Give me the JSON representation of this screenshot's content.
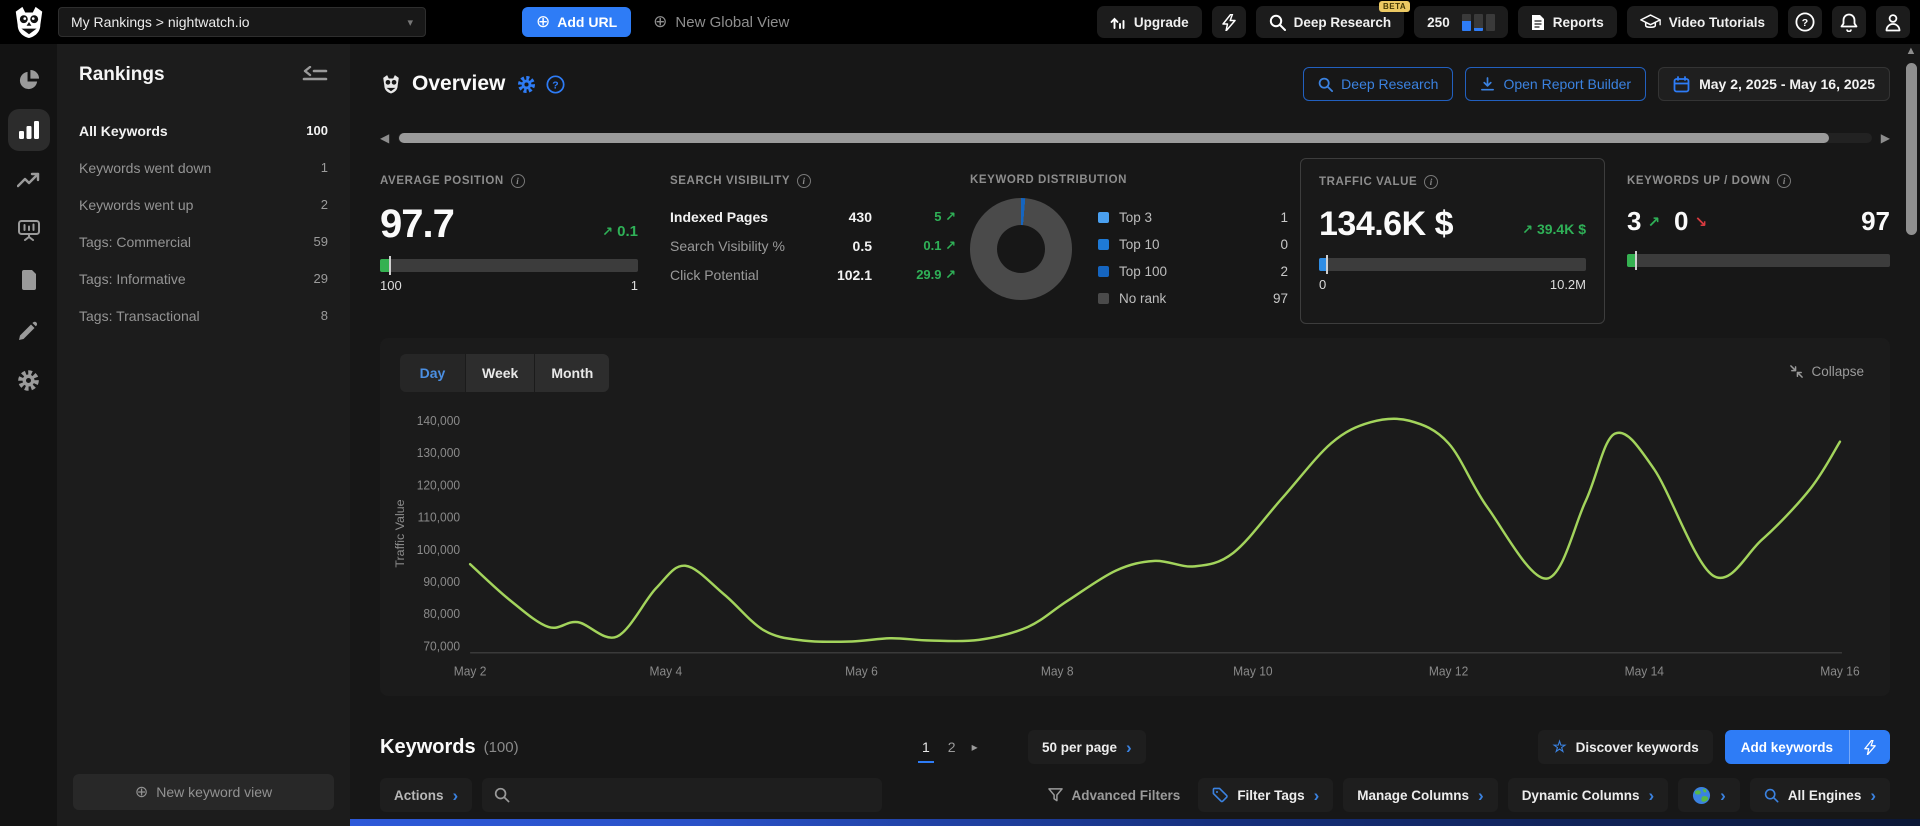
{
  "icons": {
    "up": "↗",
    "down": "↘",
    "back": "◀",
    "fwd": "▶",
    "vup": "▲",
    "chev": "›",
    "pg_next": "▸",
    "caret": "▾",
    "plus": "⊕",
    "star": "☆",
    "q": "?",
    "i": "i"
  },
  "topbar": {
    "project_selector": "My Rankings > nightwatch.io",
    "add_url": "Add URL",
    "new_global_view": "New Global View",
    "upgrade": "Upgrade",
    "deep_research": "Deep Research",
    "beta": "BETA",
    "credits": "250",
    "reports": "Reports",
    "video_tutorials": "Video Tutorials"
  },
  "sidebar": {
    "title": "Rankings",
    "items": [
      {
        "label": "All Keywords",
        "count": "100",
        "active": true
      },
      {
        "label": "Keywords went down",
        "count": "1",
        "active": false
      },
      {
        "label": "Keywords went up",
        "count": "2",
        "active": false
      },
      {
        "label": "Tags: Commercial",
        "count": "59",
        "active": false
      },
      {
        "label": "Tags: Informative",
        "count": "29",
        "active": false
      },
      {
        "label": "Tags: Transactional",
        "count": "8",
        "active": false
      }
    ],
    "new_keyword_view": "New keyword view"
  },
  "header": {
    "title": "Overview",
    "deep_research": "Deep Research",
    "open_report_builder": "Open Report Builder",
    "date_range": "May 2, 2025 - May 16, 2025"
  },
  "stats": {
    "average_position": {
      "title": "AVERAGE POSITION",
      "value": "97.7",
      "change": "0.1",
      "scale_left": "100",
      "scale_right": "1",
      "fill_color": "#35b151"
    },
    "search_visibility": {
      "title": "SEARCH VISIBILITY",
      "rows": [
        {
          "label": "Indexed Pages",
          "value": "430",
          "change": "5"
        },
        {
          "label": "Search Visibility %",
          "value": "0.5",
          "change": "0.1"
        },
        {
          "label": "Click Potential",
          "value": "102.1",
          "change": "29.9"
        }
      ]
    },
    "keyword_distribution": {
      "title": "KEYWORD DISTRIBUTION",
      "legend": [
        {
          "label": "Top 3",
          "value": "1",
          "color": "#4aa0f0"
        },
        {
          "label": "Top 10",
          "value": "0",
          "color": "#1e7ad6"
        },
        {
          "label": "Top 100",
          "value": "2",
          "color": "#1565c0"
        },
        {
          "label": "No rank",
          "value": "97",
          "color": "#4a4a4a"
        }
      ]
    },
    "traffic_value": {
      "title": "TRAFFIC VALUE",
      "value": "134.6K $",
      "change": "39.4K $",
      "scale_left": "0",
      "scale_right": "10.2M",
      "fill_color": "#2f8de4"
    },
    "keywords_up_down": {
      "title": "KEYWORDS UP / DOWN",
      "up": "3",
      "down": "0",
      "total": "97",
      "fill_color": "#35b151"
    }
  },
  "chart": {
    "tabs": [
      "Day",
      "Week",
      "Month"
    ],
    "active_tab": "Day",
    "collapse_label": "Collapse"
  },
  "chart_data": {
    "type": "line",
    "title": "Traffic Value by day",
    "ylabel": "Traffic Value",
    "line_color": "#a3d45c",
    "grid": false,
    "xlim": [
      2,
      16
    ],
    "ylim": [
      68000,
      142000
    ],
    "x_ticks": [
      {
        "day": 2,
        "label": "May 2"
      },
      {
        "day": 4,
        "label": "May 4"
      },
      {
        "day": 6,
        "label": "May 6"
      },
      {
        "day": 8,
        "label": "May 8"
      },
      {
        "day": 10,
        "label": "May 10"
      },
      {
        "day": 12,
        "label": "May 12"
      },
      {
        "day": 14,
        "label": "May 14"
      },
      {
        "day": 16,
        "label": "May 16"
      }
    ],
    "y_ticks": [
      {
        "value": 70000,
        "label": "70,000"
      },
      {
        "value": 80000,
        "label": "80,000"
      },
      {
        "value": 90000,
        "label": "90,000"
      },
      {
        "value": 100000,
        "label": "100,000"
      },
      {
        "value": 110000,
        "label": "110,000"
      },
      {
        "value": 120000,
        "label": "120,000"
      },
      {
        "value": 130000,
        "label": "130,000"
      },
      {
        "value": 140000,
        "label": "140,000"
      }
    ],
    "series": [
      {
        "name": "Traffic Value",
        "points": [
          [
            2.0,
            95500
          ],
          [
            2.4,
            84500
          ],
          [
            2.8,
            76000
          ],
          [
            3.1,
            77500
          ],
          [
            3.5,
            73000
          ],
          [
            3.9,
            88000
          ],
          [
            4.2,
            95000
          ],
          [
            4.6,
            86000
          ],
          [
            5.0,
            75000
          ],
          [
            5.4,
            71800
          ],
          [
            5.9,
            71500
          ],
          [
            6.3,
            72500
          ],
          [
            6.7,
            71800
          ],
          [
            7.2,
            72000
          ],
          [
            7.7,
            76000
          ],
          [
            8.1,
            84000
          ],
          [
            8.6,
            93500
          ],
          [
            9.0,
            96500
          ],
          [
            9.4,
            94800
          ],
          [
            9.8,
            99000
          ],
          [
            10.3,
            116000
          ],
          [
            10.8,
            133000
          ],
          [
            11.2,
            139500
          ],
          [
            11.6,
            140000
          ],
          [
            12.0,
            133000
          ],
          [
            12.4,
            113000
          ],
          [
            13.0,
            91000
          ],
          [
            13.4,
            115000
          ],
          [
            13.7,
            136000
          ],
          [
            14.1,
            125000
          ],
          [
            14.7,
            92000
          ],
          [
            15.2,
            103000
          ],
          [
            15.7,
            119000
          ],
          [
            16.0,
            133500
          ]
        ]
      }
    ]
  },
  "keywords": {
    "title": "Keywords",
    "count": "(100)",
    "pages": [
      "1",
      "2"
    ],
    "active_page": "1",
    "per_page": "50 per page",
    "discover": "Discover keywords",
    "add": "Add keywords",
    "actions": "Actions",
    "advanced_filters": "Advanced Filters",
    "filter_tags": "Filter Tags",
    "manage_columns": "Manage Columns",
    "dynamic_columns": "Dynamic Columns",
    "all_engines": "All Engines"
  }
}
